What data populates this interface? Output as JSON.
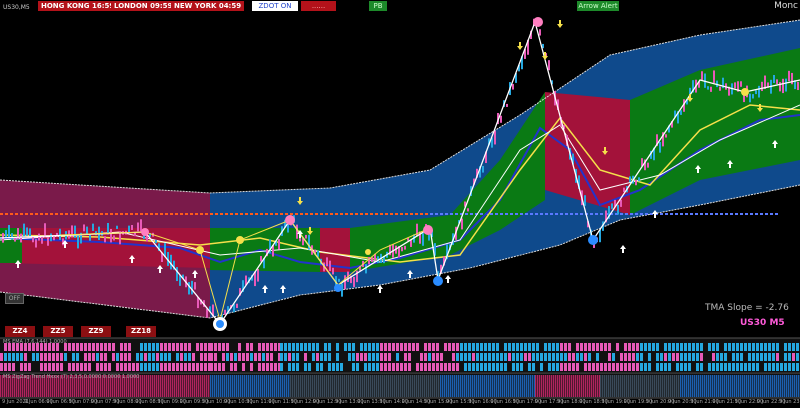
{
  "header": {
    "symbol": "US30,M5",
    "sessions": [
      {
        "label": "HONG KONG 16:59"
      },
      {
        "label": "LONDON 09:59"
      },
      {
        "label": "NEW YORK 04:59"
      }
    ],
    "buttons": [
      {
        "label": "ZDOT ON"
      },
      {
        "label": "......"
      },
      {
        "label": "PB"
      },
      {
        "label": "Arrow Alert"
      }
    ],
    "corner_label": "Monc"
  },
  "chart": {
    "off_button": "OFF",
    "tma_slope": "TMA Slope = -2.76",
    "pair_label": "US30 M5",
    "zigzag_buttons": [
      "ZZ4",
      "ZZ5",
      "ZZ9",
      "ZZ18"
    ]
  },
  "indicators": {
    "ema_title": "MS EMA (7,6,144) 1.0000",
    "zigzag_title": "MS ZigZag Trend Hxxx (7) 2,3,5,0.0000 0.0000 1.0000"
  },
  "time_axis": {
    "ticks": [
      "9 Jun 2021",
      "9 Jun 06:00",
      "9 Jun 06:30",
      "9 Jun 07:00",
      "9 Jun 07:30",
      "9 Jun 08:00",
      "9 Jun 08:30",
      "9 Jun 09:00",
      "9 Jun 09:30",
      "9 Jun 10:00",
      "9 Jun 10:30",
      "9 Jun 11:00",
      "9 Jun 11:30",
      "9 Jun 12:00",
      "9 Jun 12:30",
      "9 Jun 13:00",
      "9 Jun 13:30",
      "9 Jun 14:00",
      "9 Jun 14:30",
      "9 Jun 15:00",
      "9 Jun 15:30",
      "9 Jun 16:00",
      "9 Jun 16:30",
      "9 Jun 17:00",
      "9 Jun 17:30",
      "9 Jun 18:00",
      "9 Jun 18:30",
      "9 Jun 19:00",
      "9 Jun 19:30",
      "9 Jun 20:00",
      "9 Jun 20:30",
      "9 Jun 21:00",
      "9 Jun 21:30",
      "9 Jun 22:00",
      "9 Jun 22:30",
      "9 Jun 23:00"
    ]
  },
  "colors": {
    "band_blue": "#0f4a8c",
    "band_maroon": "#7a1a4a",
    "band_green": "#0a7a14",
    "band_red": "#a3123a",
    "session_red": "#b3121a",
    "cyan_bar": "#25a8e0",
    "pink_bar": "#e85ab8",
    "level_orange": "#ff5a1a",
    "level_blue": "#5a78ff"
  }
}
